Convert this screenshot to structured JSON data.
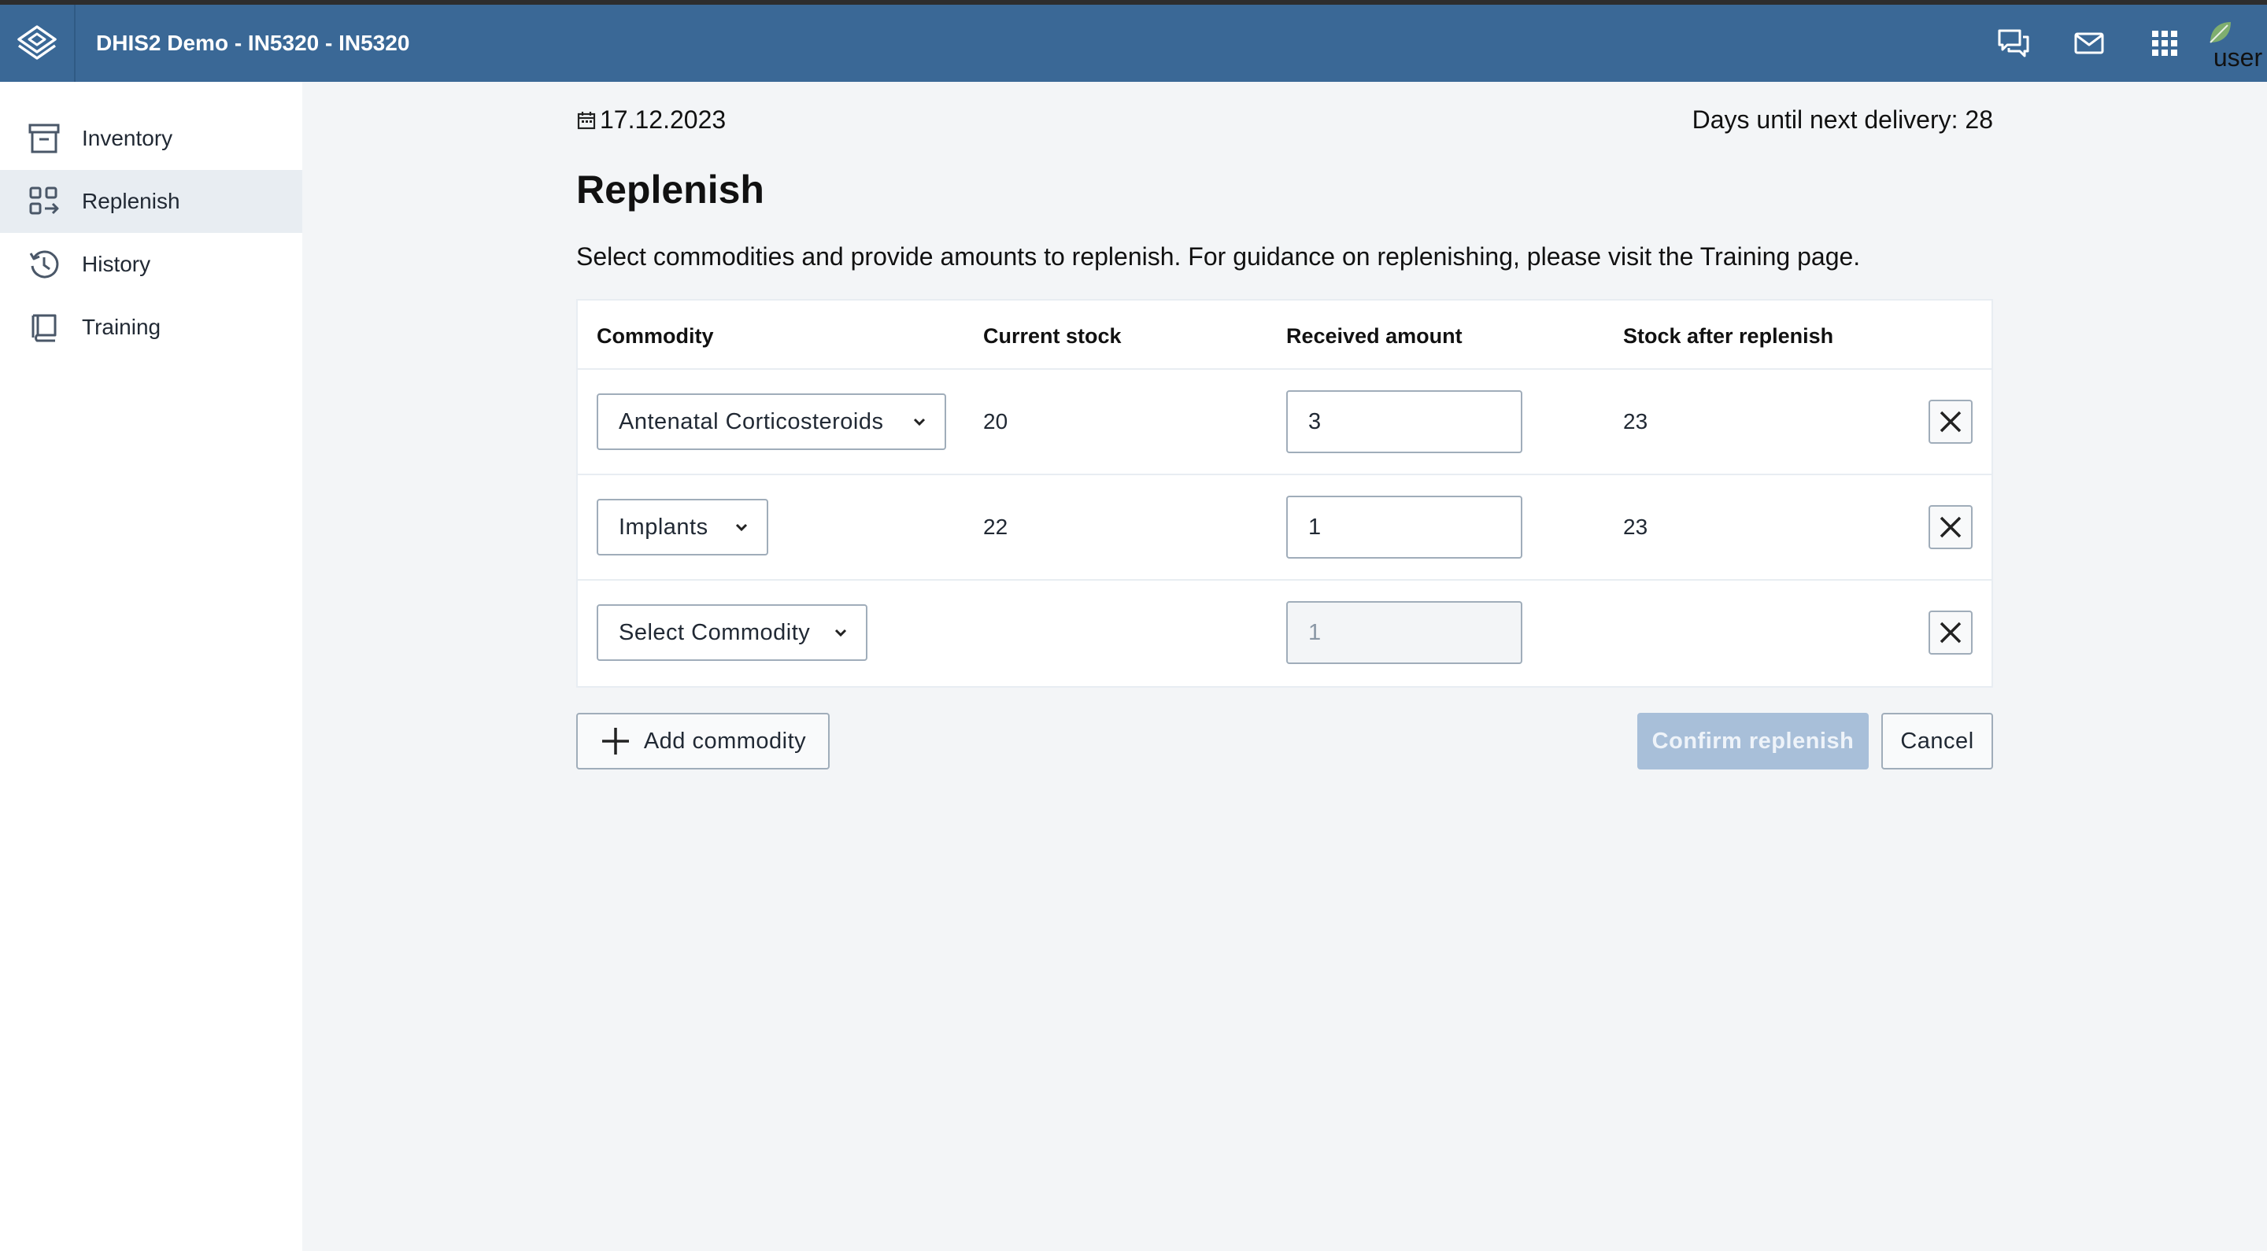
{
  "header": {
    "app_title": "DHIS2 Demo - IN5320 - IN5320",
    "icons": [
      "logo-icon",
      "chat-icon",
      "mail-icon",
      "apps-grid-icon"
    ],
    "avatar_label": "user"
  },
  "sidebar": {
    "items": [
      {
        "label": "Inventory",
        "icon": "archive-icon",
        "active": false
      },
      {
        "label": "Replenish",
        "icon": "replenish-icon",
        "active": true
      },
      {
        "label": "History",
        "icon": "history-icon",
        "active": false
      },
      {
        "label": "Training",
        "icon": "book-icon",
        "active": false
      }
    ]
  },
  "main": {
    "date": "17.12.2023",
    "days_until_delivery": "Days until next delivery: 28",
    "title": "Replenish",
    "description": "Select commodities and provide amounts to replenish. For guidance on replenishing, please visit the Training page.",
    "table": {
      "headers": [
        "Commodity",
        "Current stock",
        "Received amount",
        "Stock after replenish"
      ],
      "rows": [
        {
          "commodity": "Antenatal Corticosteroids",
          "current_stock": "20",
          "received_amount": "3",
          "received_placeholder": "",
          "stock_after": "23"
        },
        {
          "commodity": "Implants",
          "current_stock": "22",
          "received_amount": "1",
          "received_placeholder": "",
          "stock_after": "23"
        },
        {
          "commodity": "Select Commodity",
          "current_stock": "",
          "received_amount": "",
          "received_placeholder": "1",
          "stock_after": ""
        }
      ]
    },
    "buttons": {
      "add": "Add commodity",
      "confirm": "Confirm replenish",
      "cancel": "Cancel"
    }
  },
  "colors": {
    "header_bg": "#3a6896",
    "active_nav_bg": "#e8edf2",
    "confirm_disabled_bg": "#a8bfd9"
  }
}
